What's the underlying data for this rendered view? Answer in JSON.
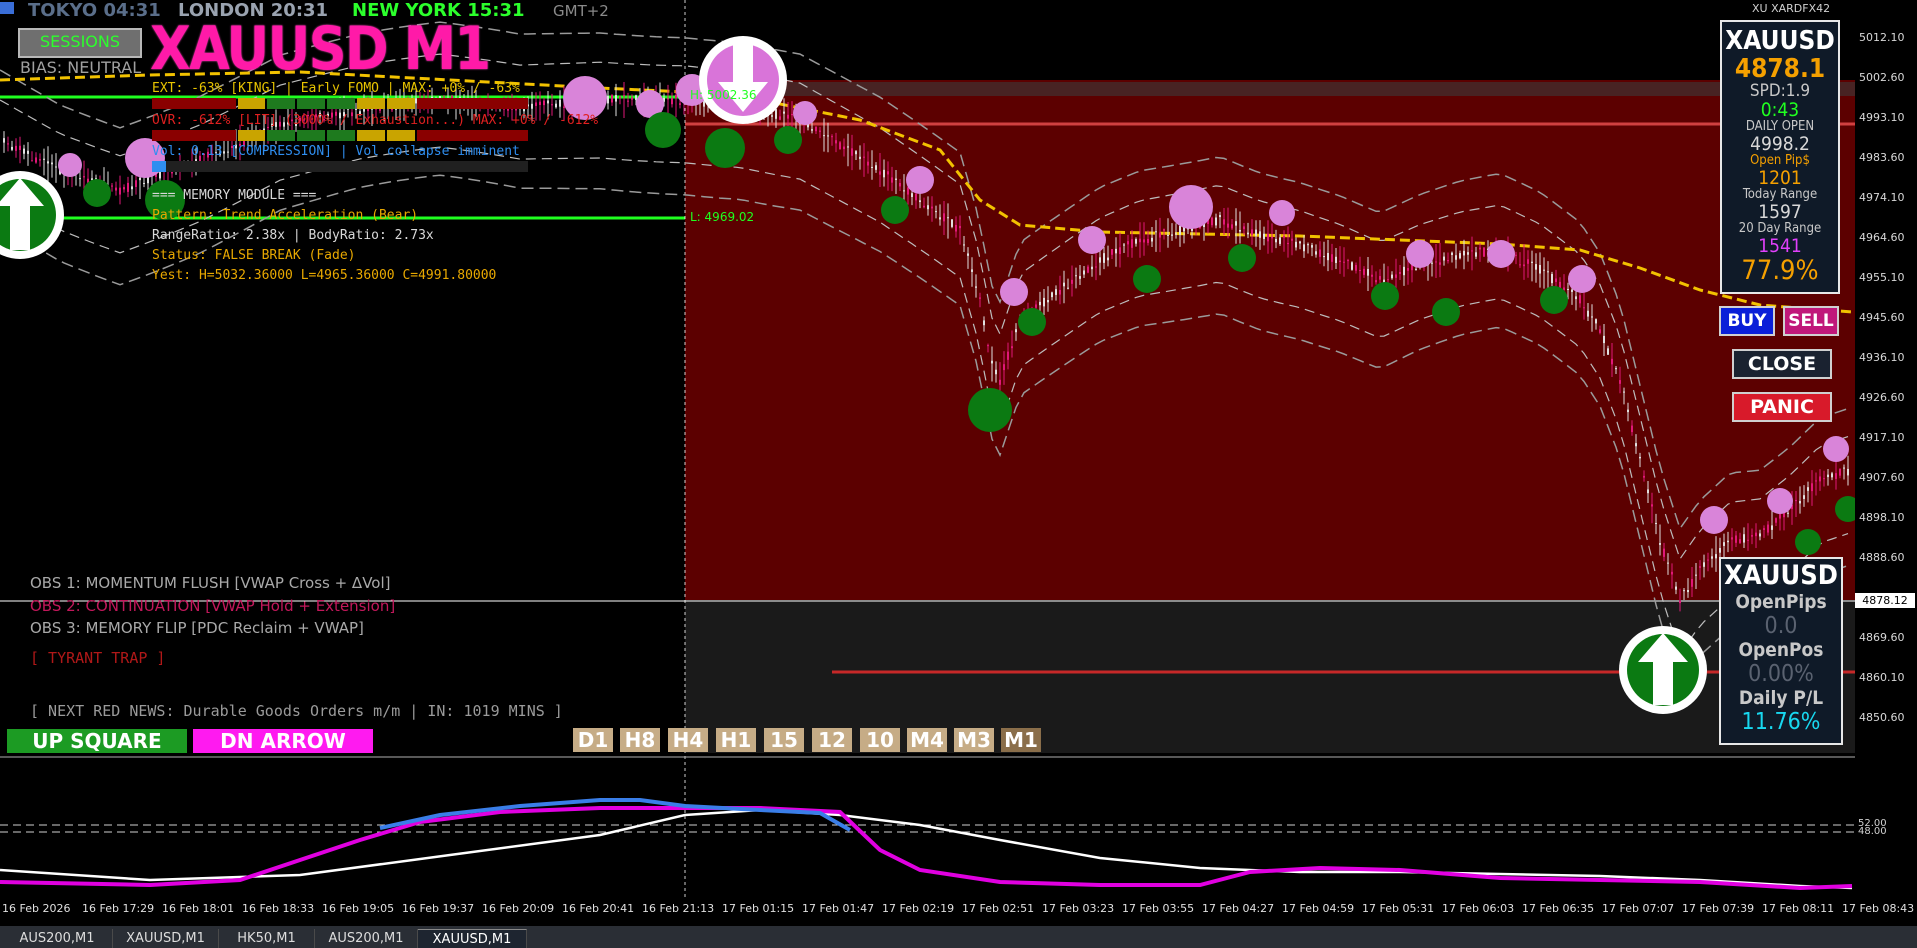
{
  "sessions_bar": {
    "tokyo": "TOKYO 04:31",
    "london": "LONDON 20:31",
    "new_york": "NEW YORK 15:31",
    "gmt": "GMT+2"
  },
  "title": "XAUUSD M1",
  "sessions_button": "SESSIONS",
  "bias": "BIAS: NEUTRAL",
  "info_lines": {
    "ext": "EXT: -63% [KING] | Early FOMO | MAX: +0% / -63%",
    "ovr": "OVR: -612% [LIT] (3000% / Exhaustion...)  MAX: +0% / -612%",
    "vol": "Vol: 0.13 [COMPRESSION] | Vol collapse imminent",
    "memory_header": "=== MEMORY MODULE ===",
    "pattern": "Pattern: Trend Acceleration (Bear)",
    "ratio": "RangeRatio: 2.38x | BodyRatio: 2.73x",
    "status": "Status: FALSE BREAK (Fade)",
    "yest": "Yest: H=5032.36000 L=4965.36000 C=4991.80000"
  },
  "level_labels": {
    "high": "H: 5002.36",
    "low": "L: 4969.02"
  },
  "obs": [
    {
      "text": "OBS 1: MOMENTUM FLUSH [VWAP Cross + ΔVol]",
      "color": "#a9a9a9"
    },
    {
      "text": "OBS 2: CONTINUATION [VWAP Hold + Extension]",
      "color": "#c2185b"
    },
    {
      "text": "OBS 3: MEMORY FLIP [PDC Reclaim + VWAP]",
      "color": "#a9a9a9"
    }
  ],
  "tyrant": "[ TYRANT TRAP ]",
  "news": "[ NEXT RED NEWS: Durable Goods Orders m/m | IN: 1019 MINS ]",
  "signal_buttons": {
    "up": "UP SQUARE",
    "down": "DN ARROW"
  },
  "timeframes": [
    "D1",
    "H8",
    "H4",
    "H1",
    "15",
    "12",
    "10",
    "M4",
    "M3",
    "M1"
  ],
  "active_timeframe": "M1",
  "top_right_tag": "XU XARDFX42",
  "info_panel": {
    "symbol": "XAUUSD",
    "price": "4878.1",
    "spread": "SPD:1.9",
    "timer": "0:43",
    "daily_open_label": "DAILY OPEN",
    "daily_open": "4998.2",
    "open_pips_label": "Open Pip$",
    "open_pips": "1201",
    "today_range_label": "Today Range",
    "today_range": "1597",
    "day20_range_label": "20 Day Range",
    "day20_range": "1541",
    "ratio": "77.9%"
  },
  "trade_buttons": {
    "buy": "BUY",
    "sell": "SELL",
    "close": "CLOSE",
    "panic": "PANIC"
  },
  "pnl_panel": {
    "symbol": "XAUUSD",
    "open_pips_label": "OpenPips",
    "open_pips": "0.0",
    "open_pos_label": "OpenPos",
    "open_pos": "0.00%",
    "daily_pl_label": "Daily P/L",
    "daily_pl": "11.76%"
  },
  "price_axis": [
    "5012.10",
    "5002.60",
    "4993.10",
    "4983.60",
    "4974.10",
    "4964.60",
    "4955.10",
    "4945.60",
    "4936.10",
    "4926.60",
    "4917.10",
    "4907.60",
    "4898.10",
    "4888.60",
    "4869.60",
    "4860.10",
    "4850.60"
  ],
  "current_price_tag": "4878.12",
  "indicator_levels": [
    "52.00",
    "48.00"
  ],
  "time_axis": [
    "16 Feb 2026",
    "16 Feb 17:29",
    "16 Feb 18:01",
    "16 Feb 18:33",
    "16 Feb 19:05",
    "16 Feb 19:37",
    "16 Feb 20:09",
    "16 Feb 20:41",
    "16 Feb 21:13",
    "17 Feb 01:15",
    "17 Feb 01:47",
    "17 Feb 02:19",
    "17 Feb 02:51",
    "17 Feb 03:23",
    "17 Feb 03:55",
    "17 Feb 04:27",
    "17 Feb 04:59",
    "17 Feb 05:31",
    "17 Feb 06:03",
    "17 Feb 06:35",
    "17 Feb 07:07",
    "17 Feb 07:39",
    "17 Feb 08:11",
    "17 Feb 08:43"
  ],
  "tabs": [
    "AUS200,M1",
    "XAUUSD,M1",
    "HK50,M1",
    "AUS200,M1",
    "XAUUSD,M1"
  ],
  "active_tab": 4,
  "colors": {
    "background": "#000000",
    "red_zone": "#5c0000",
    "bull_dot": "#0b7a12",
    "bear_dot": "#d984d9",
    "vwap": "#f2c200",
    "price_line": "#ffffff"
  }
}
